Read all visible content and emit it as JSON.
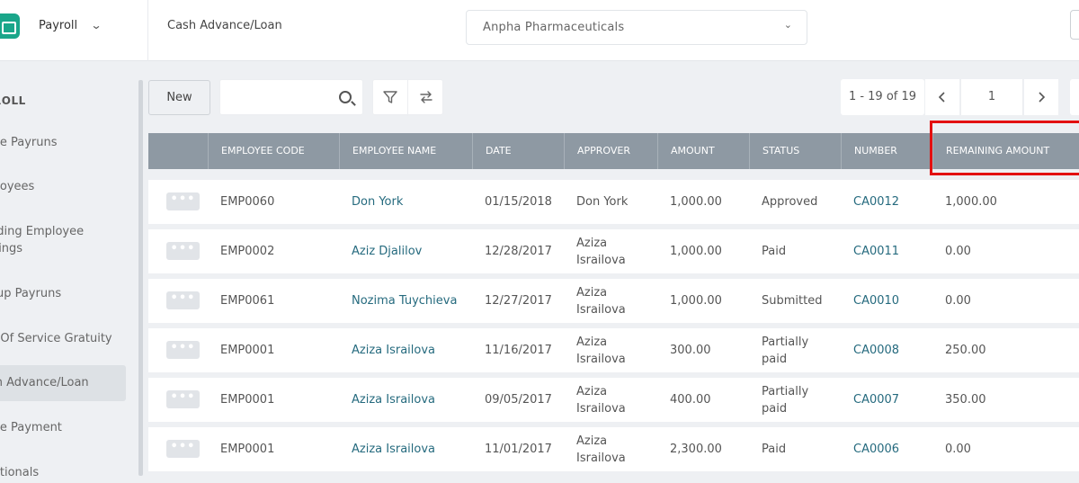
{
  "header": {
    "app_name": "Payroll",
    "breadcrumb": "Cash Advance/Loan",
    "company": "Anpha Pharmaceuticals"
  },
  "sidebar": {
    "heading": "ROLL",
    "items": [
      {
        "label": "gle Payruns"
      },
      {
        "label": "ployees"
      },
      {
        "label": "nding Employee",
        "label2": "ttings"
      },
      {
        "label": "oup Payruns"
      },
      {
        "label": "d Of Service Gratuity"
      },
      {
        "label": "sh Advance/Loan",
        "active": true
      },
      {
        "label": "gle Payment"
      },
      {
        "label": "ditionals"
      }
    ]
  },
  "toolbar": {
    "new_label": "New",
    "search_placeholder": "",
    "pager_info": "1 - 19 of 19",
    "page": "1"
  },
  "table": {
    "columns": [
      "EMPLOYEE CODE",
      "EMPLOYEE NAME",
      "DATE",
      "APPROVER",
      "AMOUNT",
      "STATUS",
      "NUMBER",
      "REMAINING AMOUNT"
    ],
    "rows": [
      {
        "code": "EMP0060",
        "name": "Don York",
        "date": "01/15/2018",
        "approver": "Don York",
        "approver2": "",
        "amount": "1,000.00",
        "status": "Approved",
        "status2": "",
        "number": "CA0012",
        "remaining": "1,000.00"
      },
      {
        "code": "EMP0002",
        "name": "Aziz Djalilov",
        "date": "12/28/2017",
        "approver": "Aziza",
        "approver2": "Israilova",
        "amount": "1,000.00",
        "status": "Paid",
        "status2": "",
        "number": "CA0011",
        "remaining": "0.00"
      },
      {
        "code": "EMP0061",
        "name": "Nozima Tuychieva",
        "date": "12/27/2017",
        "approver": "Aziza",
        "approver2": "Israilova",
        "amount": "1,000.00",
        "status": "Submitted",
        "status2": "",
        "number": "CA0010",
        "remaining": "0.00"
      },
      {
        "code": "EMP0001",
        "name": "Aziza Israilova",
        "date": "11/16/2017",
        "approver": "Aziza",
        "approver2": "Israilova",
        "amount": "300.00",
        "status": "Partially",
        "status2": "paid",
        "number": "CA0008",
        "remaining": "250.00"
      },
      {
        "code": "EMP0001",
        "name": "Aziza Israilova",
        "date": "09/05/2017",
        "approver": "Aziza",
        "approver2": "Israilova",
        "amount": "400.00",
        "status": "Partially",
        "status2": "paid",
        "number": "CA0007",
        "remaining": "350.00"
      },
      {
        "code": "EMP0001",
        "name": "Aziza Israilova",
        "date": "11/01/2017",
        "approver": "Aziza",
        "approver2": "Israilova",
        "amount": "2,300.00",
        "status": "Paid",
        "status2": "",
        "number": "CA0006",
        "remaining": "0.00"
      }
    ]
  },
  "colors": {
    "header_bg": "#8e99a3",
    "link": "#256a7e",
    "highlight": "#e31010",
    "brand": "#1aa68a"
  }
}
